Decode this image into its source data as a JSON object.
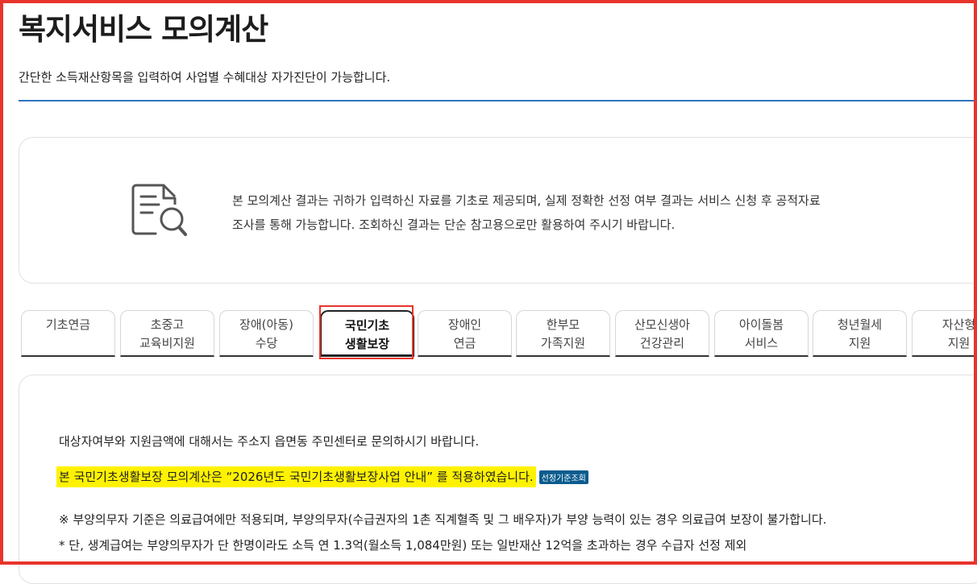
{
  "page": {
    "title": "복지서비스 모의계산",
    "subtitle": "간단한 소득재산항목을 입력하여 사업별 수혜대상 자가진단이 가능합니다."
  },
  "notice": {
    "icon": "document-search-icon",
    "line1": "본 모의계산 결과는 귀하가 입력하신 자료를 기초로 제공되며, 실제 정확한 선정 여부 결과는 서비스 신청 후 공적자료",
    "line2": "조사를 통해 가능합니다. 조회하신 결과는 단순 참고용으로만 활용하여 주시기 바랍니다."
  },
  "tabs": [
    {
      "line1": "기초연금",
      "line2": ""
    },
    {
      "line1": "초중고",
      "line2": "교육비지원"
    },
    {
      "line1": "장애(아동)",
      "line2": "수당"
    },
    {
      "line1": "국민기초",
      "line2": "생활보장"
    },
    {
      "line1": "장애인",
      "line2": "연금"
    },
    {
      "line1": "한부모",
      "line2": "가족지원"
    },
    {
      "line1": "산모신생아",
      "line2": "건강관리"
    },
    {
      "line1": "아이돌봄",
      "line2": "서비스"
    },
    {
      "line1": "청년월세",
      "line2": "지원"
    },
    {
      "line1": "자산형",
      "line2": "지원"
    }
  ],
  "active_tab": "국민기초 생활보장",
  "content": {
    "inquiry": "대상자여부와 지원금액에 대해서는 주소지 읍면동 주민센터로 문의하시기 바랍니다.",
    "applied_notice": "본 국민기초생활보장 모의계산은 “2026년도 국민기초생활보장사업 안내” 를 적용하였습니다.",
    "criteria_badge": "선정기준조회",
    "note1": "※ 부양의무자 기준은 의료급여에만 적용되며, 부양의무자(수급권자의 1촌 직계혈족 및 그 배우자)가 부양 능력이 있는 경우 의료급여 보장이 불가합니다.",
    "note2": "* 단, 생계급여는 부양의무자가 단 한명이라도 소득 연 1.3억(월소득 1,084만원) 또는 일반재산 12억을 초과하는 경우 수급자 선정 제외"
  },
  "colors": {
    "accent_rule": "#2f74c0",
    "highlight": "#fff200",
    "badge": "#0b5c8e",
    "frame": "#e8342c"
  }
}
